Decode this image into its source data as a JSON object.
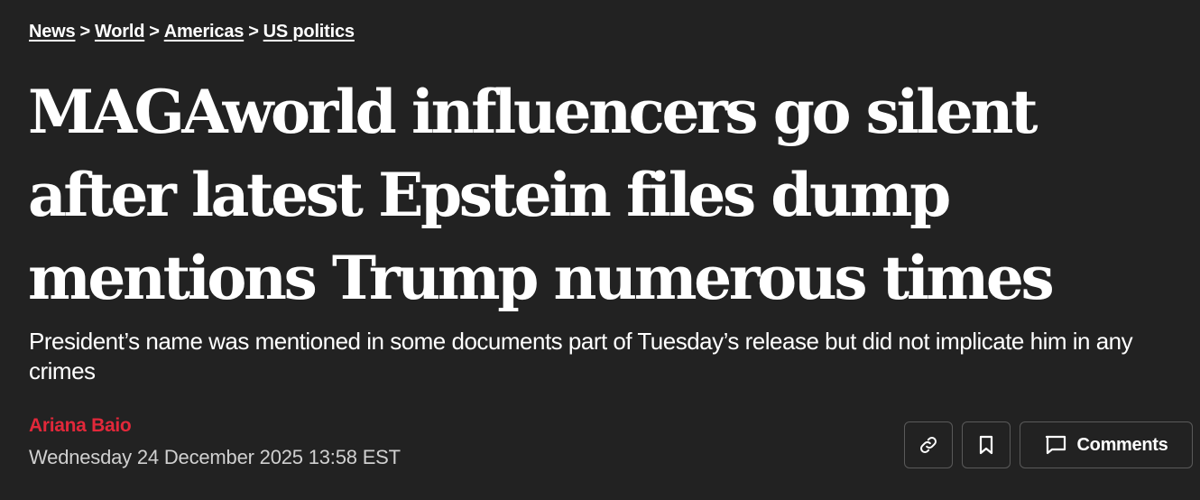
{
  "breadcrumb": {
    "items": [
      "News",
      "World",
      "Americas",
      "US politics"
    ],
    "separator": ">"
  },
  "article": {
    "headline_lines": [
      "MAGAworld influencers go silent",
      "after latest Epstein files dump",
      "mentions Trump numerous times"
    ],
    "standfirst": "President’s name was mentioned in some documents part of Tuesday’s release but did not implicate him in any crimes",
    "author": "Ariana Baio",
    "date": "Wednesday 24 December 2025 13:58 EST"
  },
  "actions": {
    "copy_link_icon": "link-icon",
    "bookmark_icon": "bookmark-icon",
    "comments_icon": "comment-icon",
    "comments_label": "Comments"
  },
  "colors": {
    "background": "#222222",
    "text": "#ffffff",
    "author": "#e2283a",
    "date": "#d0d0d0",
    "button_border": "#5a5a5a"
  }
}
